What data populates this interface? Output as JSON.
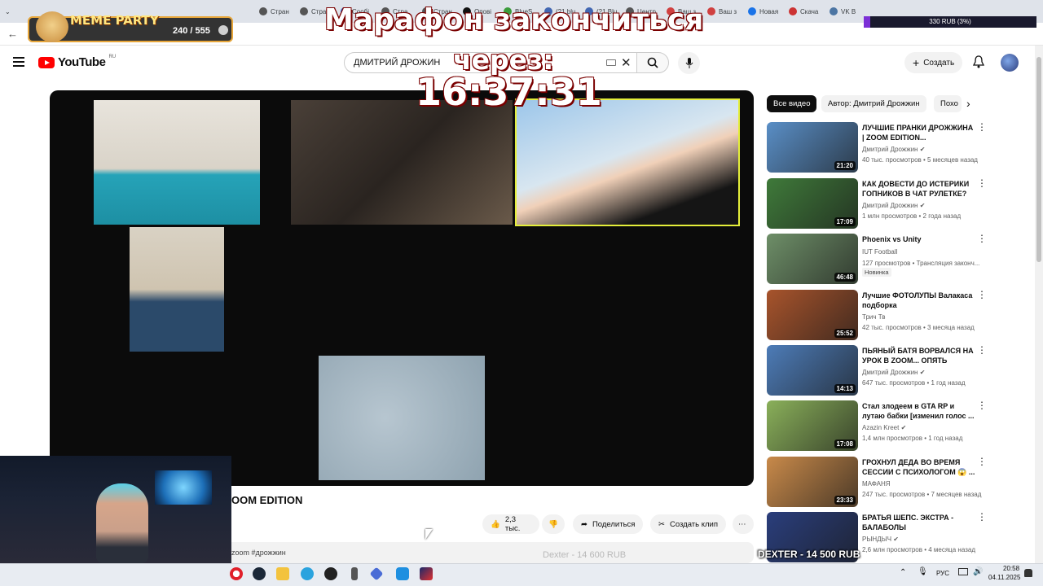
{
  "browser": {
    "tabs": [
      "Стран",
      "Стран",
      "Сообі",
      "Стра",
      "Стран",
      "Опові",
      "BlueS",
      "(21 blu",
      "(21 Blu",
      "Центр",
      "Ваш з",
      "Ваш з",
      "Новая",
      "Скача",
      "VK B"
    ]
  },
  "overlay": {
    "meme_party_label": "MEME PARTY",
    "meme_party_count": "240 / 555",
    "marathon_line1": "Марафон закончиться",
    "marathon_line2": "через:",
    "timer": "16:37:31",
    "donation_goal": "330 RUB (3%)",
    "donation_bottom": "Dexter - 14 600 RUB",
    "dexter_label": "DEXTER - 14 500 RUB"
  },
  "header": {
    "logo_text": "YouTube",
    "logo_country": "RU",
    "search_value": "ДМИТРИЙ ДРОЖИН",
    "create_label": "Создать"
  },
  "video": {
    "title": "OOM EDITION",
    "likes": "2,3 тыс.",
    "share_label": "Поделиться",
    "clip_label": "Создать клип",
    "hashtags": "zoom #дрожжин"
  },
  "chips": [
    {
      "label": "Все видео"
    },
    {
      "label": "Автор: Дмитрий Дрожжин"
    },
    {
      "label": "Похо"
    }
  ],
  "recommendations": [
    {
      "title": "ЛУЧШИЕ ПРАНКИ ДРОЖЖИНА | ZOOM EDITION...",
      "channel": "Дмитрий Дрожжин ✔",
      "meta": "40 тыс. просмотров • 5 месяцев назад",
      "duration": "21:20",
      "thumb_color": "#5a8fc7"
    },
    {
      "title": "КАК ДОВЕСТИ ДО ИСТЕРИКИ ГОПНИКОВ В ЧАТ РУЛЕТКЕ?",
      "channel": "Дмитрий Дрожжин ✔",
      "meta": "1 млн просмотров • 2 года назад",
      "duration": "17:09",
      "thumb_color": "#3f7a3a"
    },
    {
      "title": "Phoenix vs Unity",
      "channel": "IUT Football",
      "meta": "127 просмотров • Трансляция законч...",
      "duration": "46:48",
      "badge": "Новинка",
      "thumb_color": "#6e8f68"
    },
    {
      "title": "Лучшие ФОТОЛУПЫ Валакаса подборка",
      "channel": "Трич Тв",
      "meta": "42 тыс. просмотров • 3 месяца назад",
      "duration": "25:52",
      "thumb_color": "#a8542c"
    },
    {
      "title": "ПЬЯНЫЙ БАТЯ ВОРВАЛСЯ НА УРОК В ZOOM... ОПЯТЬ",
      "channel": "Дмитрий Дрожжин ✔",
      "meta": "647 тыс. просмотров • 1 год назад",
      "duration": "14:13",
      "thumb_color": "#4d7cb8"
    },
    {
      "title": "Стал злодеем в GTA RP и лутаю бабки [изменил голос ...",
      "channel": "Azazin Kreet ✔",
      "meta": "1,4 млн просмотров • 1 год назад",
      "duration": "17:08",
      "thumb_color": "#8ab05a"
    },
    {
      "title": "ГРОХНУЛ ДЕДА ВО ВРЕМЯ СЕССИИ С ПСИХОЛОГОМ 😱 ...",
      "channel": "МАФАНЯ",
      "meta": "247 тыс. просмотров • 7 месяцев назад",
      "duration": "23:33",
      "thumb_color": "#c98a4a"
    },
    {
      "title": "БРАТЬЯ ШЕПС. ЭКСТРА - БАЛАБОЛЫ",
      "channel": "РЫНДЫЧ ✔",
      "meta": "2,6 млн просмотров • 4 месяца назад",
      "duration": "",
      "thumb_color": "#2a3e7c"
    }
  ],
  "taskbar": {
    "language": "РУС",
    "time": "20:58",
    "date": "04.11.2025"
  },
  "colors": {
    "accent_red": "#ff0000",
    "overlay_text_shadow": "#7a0000",
    "goal_bar": "#7b2fd6"
  }
}
